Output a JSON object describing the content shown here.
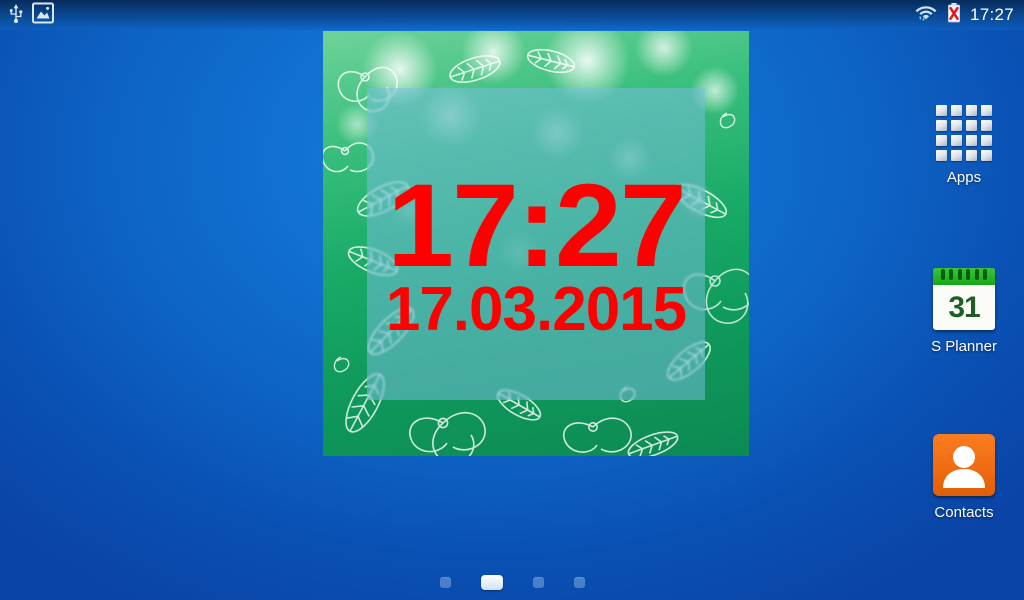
{
  "status_bar": {
    "left_icons": [
      {
        "name": "usb-icon",
        "label": "USB"
      },
      {
        "name": "screenshot-icon",
        "label": "Screenshot captured"
      }
    ],
    "right_icons": [
      {
        "name": "wifi-icon",
        "label": "Wi-Fi connected with data transfer"
      },
      {
        "name": "battery-error-icon",
        "label": "Battery error"
      }
    ],
    "clock": "17:27"
  },
  "widget": {
    "name": "clock-date-widget",
    "time": "17:27",
    "date": "17.03.2015",
    "text_color": "#ff0000",
    "panel_color": "#78bee1",
    "background_theme": "green floral bokeh"
  },
  "dock": {
    "items": [
      {
        "id": "apps",
        "label": "Apps",
        "icon": "apps-grid-icon"
      },
      {
        "id": "splanner",
        "label": "S Planner",
        "icon": "calendar-icon",
        "day": "31",
        "accent": "#17a818"
      },
      {
        "id": "contacts",
        "label": "Contacts",
        "icon": "person-icon",
        "accent": "#ef6a10"
      }
    ]
  },
  "page_indicator": {
    "total": 4,
    "active_index": 1
  },
  "wallpaper": {
    "accent": "#0d63c4"
  }
}
